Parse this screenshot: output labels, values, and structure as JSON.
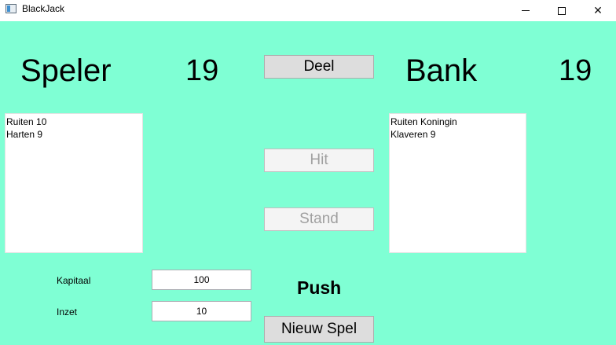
{
  "window": {
    "title": "BlackJack",
    "controls": {
      "minimize_icon": "minimize-icon",
      "maximize_icon": "maximize-icon",
      "close_icon": "close-icon",
      "close_glyph": "✕"
    }
  },
  "player": {
    "label": "Speler",
    "score": "19",
    "cards": [
      "Ruiten 10",
      "Harten 9"
    ]
  },
  "bank": {
    "label": "Bank",
    "score": "19",
    "cards": [
      "Ruiten Koningin",
      "Klaveren 9"
    ]
  },
  "buttons": {
    "deal": "Deel",
    "hit": "Hit",
    "stand": "Stand",
    "new_game": "Nieuw Spel"
  },
  "money": {
    "capital_label": "Kapitaal",
    "capital_value": "100",
    "bet_label": "Inzet",
    "bet_value": "10"
  },
  "result": "Push",
  "colors": {
    "background": "#7fffd4",
    "button": "#dddddd",
    "button_disabled": "#f4f4f4"
  }
}
